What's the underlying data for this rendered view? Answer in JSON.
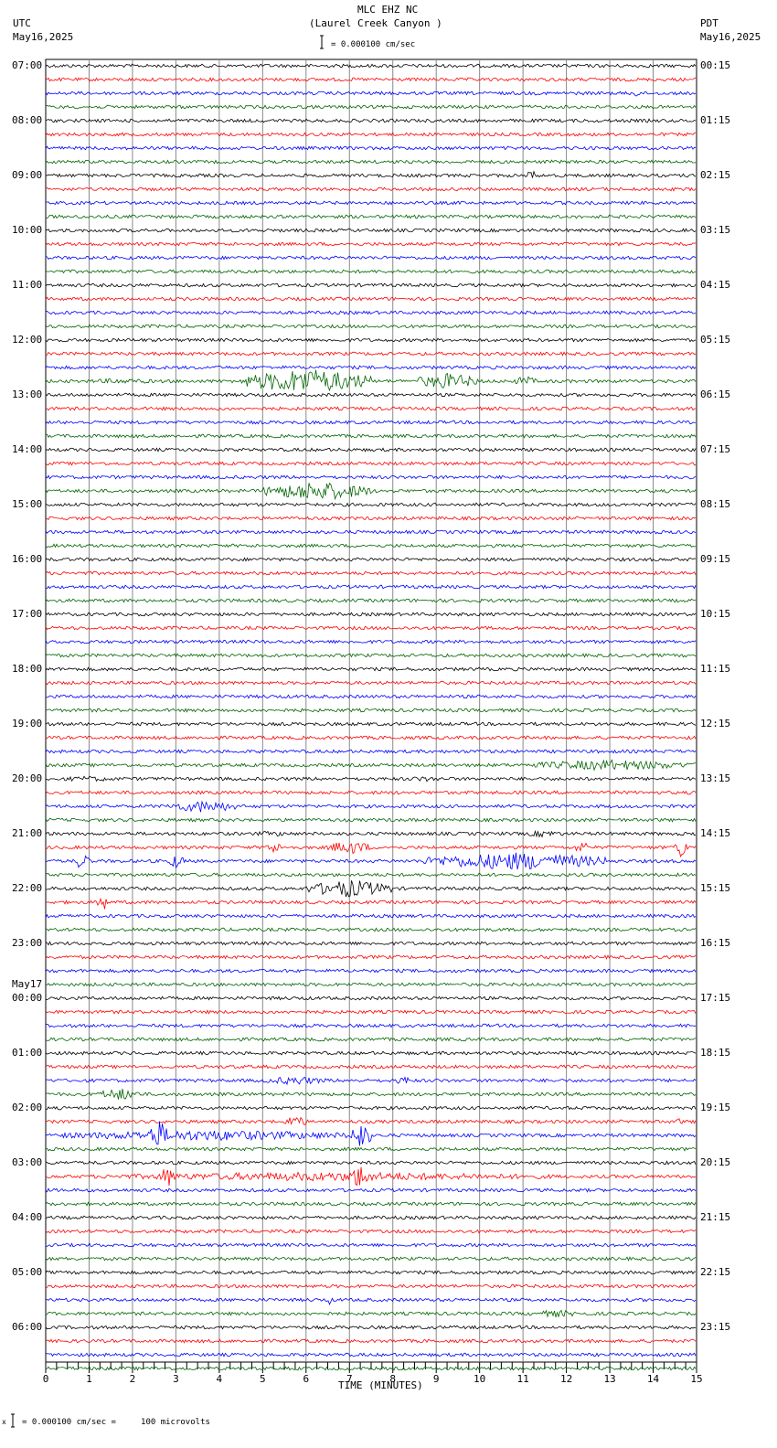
{
  "chart_data": {
    "type": "line",
    "title": "MLC EHZ NC",
    "subtitle": "(Laurel Creek Canyon )",
    "left_tz": "UTC",
    "left_date": "May16,2025",
    "right_tz": "PDT",
    "right_date": "May16,2025",
    "scale_text": "= 0.000100 cm/sec",
    "footer_text": "= 0.000100 cm/sec =     100 microvolts",
    "footer_prefix": "x",
    "xlabel": "TIME (MINUTES)",
    "xlim": [
      0,
      15
    ],
    "x_ticks": [
      "0",
      "1",
      "2",
      "3",
      "4",
      "5",
      "6",
      "7",
      "8",
      "9",
      "10",
      "11",
      "12",
      "13",
      "14",
      "15"
    ],
    "left_labels": [
      "07:00",
      "08:00",
      "09:00",
      "10:00",
      "11:00",
      "12:00",
      "13:00",
      "14:00",
      "15:00",
      "16:00",
      "17:00",
      "18:00",
      "19:00",
      "20:00",
      "21:00",
      "22:00",
      "23:00",
      "00:00",
      "01:00",
      "02:00",
      "03:00",
      "04:00",
      "05:00",
      "06:00"
    ],
    "date_change_label": "May17",
    "right_labels": [
      "00:15",
      "01:15",
      "02:15",
      "03:15",
      "04:15",
      "05:15",
      "06:15",
      "07:15",
      "08:15",
      "09:15",
      "10:15",
      "11:15",
      "12:15",
      "13:15",
      "14:15",
      "15:15",
      "16:15",
      "17:15",
      "18:15",
      "19:15",
      "20:15",
      "21:15",
      "22:15",
      "23:15"
    ],
    "lines_per_hour": 4,
    "trace_colors": [
      "#000000",
      "#ff0000",
      "#0000ff",
      "#006400"
    ],
    "bursts": [
      [
        2,
        13.4,
        13.8,
        4
      ],
      [
        8,
        11.1,
        11.3,
        7
      ],
      [
        23,
        0.5,
        3,
        3
      ],
      [
        23,
        4.5,
        7.5,
        14
      ],
      [
        23,
        8.5,
        10,
        9
      ],
      [
        23,
        10.8,
        11.3,
        6
      ],
      [
        31,
        5,
        7.5,
        11
      ],
      [
        51,
        11,
        15,
        6
      ],
      [
        52,
        0,
        2,
        3
      ],
      [
        52,
        8,
        9.5,
        3
      ],
      [
        54,
        2.8,
        4.5,
        7
      ],
      [
        56,
        4.5,
        6,
        3
      ],
      [
        56,
        11,
        12,
        4
      ],
      [
        57,
        5,
        5.5,
        6
      ],
      [
        57,
        6.5,
        7.5,
        8
      ],
      [
        57,
        12.2,
        12.5,
        8
      ],
      [
        57,
        14.5,
        14.8,
        12
      ],
      [
        58,
        0.7,
        1,
        12
      ],
      [
        58,
        2.8,
        3.2,
        8
      ],
      [
        58,
        8.7,
        13,
        10
      ],
      [
        60,
        6,
        8,
        10
      ],
      [
        61,
        1.2,
        1.4,
        14
      ],
      [
        74,
        5,
        6.5,
        5
      ],
      [
        74,
        8,
        8.5,
        5
      ],
      [
        75,
        1.2,
        2.2,
        7
      ],
      [
        77,
        5.5,
        6,
        8
      ],
      [
        77,
        14.5,
        14.7,
        4
      ],
      [
        78,
        0,
        7.5,
        6
      ],
      [
        78,
        2.4,
        2.8,
        18
      ],
      [
        78,
        7,
        7.5,
        15
      ],
      [
        81,
        1,
        12,
        5
      ],
      [
        81,
        2.6,
        3,
        12
      ],
      [
        81,
        7,
        7.5,
        14
      ],
      [
        90,
        6.5,
        6.6,
        6
      ],
      [
        91,
        11,
        12.5,
        4
      ]
    ]
  }
}
